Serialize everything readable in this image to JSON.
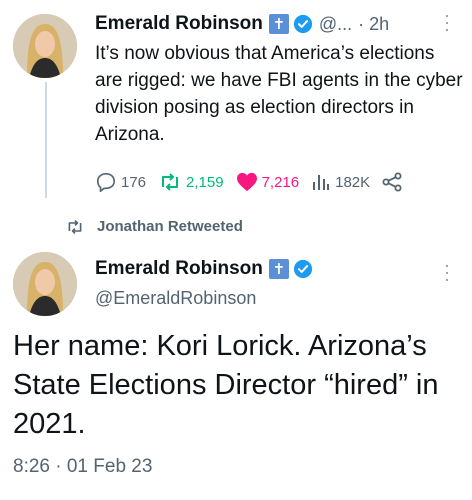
{
  "tweet1": {
    "name": "Emerald Robinson",
    "handle": "@...",
    "time": "· 2h",
    "text": "It’s now obvious that America’s elections are rigged: we have FBI agents in the cyber division posing as election directors in Arizona.",
    "replies": "176",
    "retweets": "2,159",
    "likes": "7,216",
    "views": "182K",
    "icons": [
      "cross-badge-icon",
      "verified-badge-icon",
      "more-icon",
      "reply-icon",
      "retweet-icon",
      "like-icon",
      "views-icon",
      "share-icon"
    ]
  },
  "retweeted": {
    "label": "Jonathan Retweeted"
  },
  "tweet2": {
    "name": "Emerald Robinson",
    "handle": "@EmeraldRobinson",
    "text": "Her name: Kori Lorick. Arizona’s State Elections Director “hired” in 2021.",
    "timestamp": "8:26 · 01 Feb 23"
  },
  "colors": {
    "accent_blue": "#1d9bf0",
    "retweet_green": "#00ba7c",
    "like_pink": "#f91880",
    "muted_gray": "#536471",
    "badge_blue": "#5b8fd6"
  }
}
